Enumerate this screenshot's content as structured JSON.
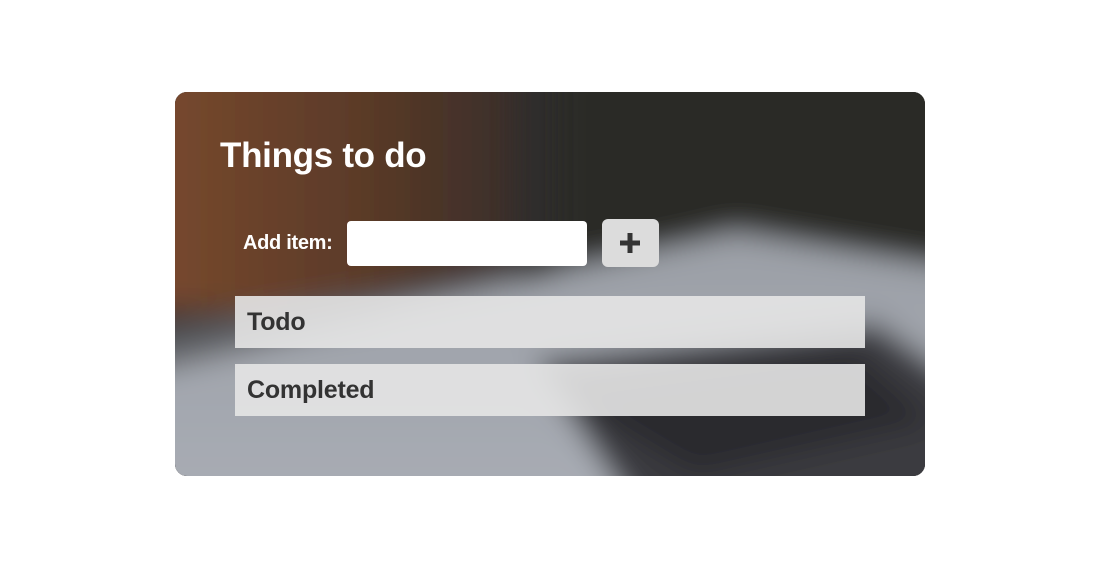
{
  "app": {
    "title": "Things to do"
  },
  "add_form": {
    "label": "Add item:",
    "input_value": "",
    "input_placeholder": "",
    "button_icon": "plus-icon"
  },
  "sections": {
    "todo_label": "Todo",
    "completed_label": "Completed"
  },
  "colors": {
    "page_background": "#ffffff",
    "title_text": "#ffffff",
    "section_background": "#e6e6e6",
    "section_text": "#333333",
    "button_background": "#dcdcdc"
  }
}
